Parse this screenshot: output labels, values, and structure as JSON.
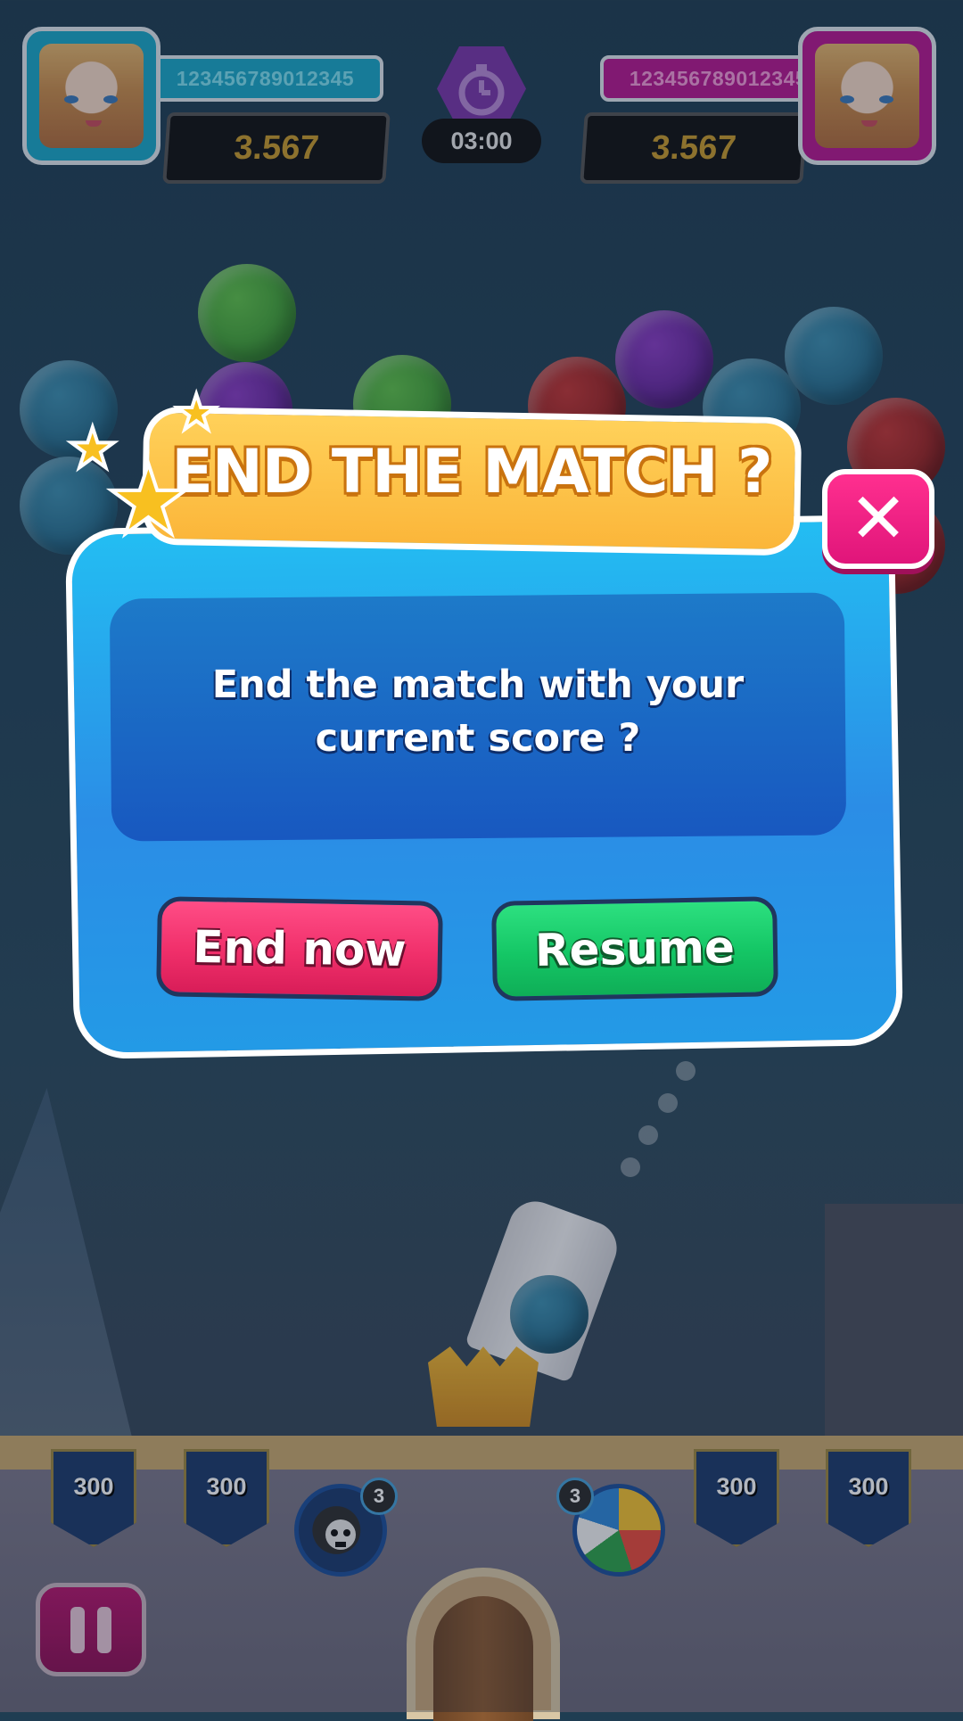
{
  "hud": {
    "player1": {
      "name": "123456789012345",
      "score": "3.567",
      "color": "#1aa7c7"
    },
    "player2": {
      "name": "123456789012345",
      "score": "3.567",
      "color": "#b5178f"
    },
    "timer": "03:00"
  },
  "dialog": {
    "title": "END THE MATCH ?",
    "message_line1": "End the match with your",
    "message_line2": "current score ?",
    "end_button": "End now",
    "resume_button": "Resume",
    "close_icon": "close-icon"
  },
  "bottom": {
    "slots": [
      "300",
      "300",
      "300",
      "300"
    ],
    "bomb_count": "3",
    "ball_count": "3"
  }
}
